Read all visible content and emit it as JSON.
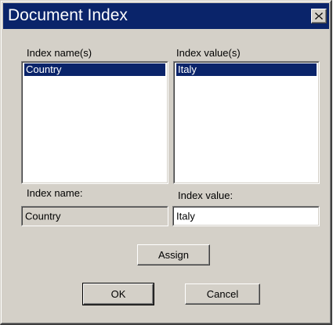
{
  "window": {
    "title": "Document Index"
  },
  "index_names": {
    "label": "Index name(s)",
    "items": [
      "Country"
    ],
    "selected_index": 0
  },
  "index_values": {
    "label": "Index value(s)",
    "items": [
      "Italy"
    ],
    "selected_index": 0
  },
  "index_name_field": {
    "label": "Index name:",
    "value": "Country"
  },
  "index_value_field": {
    "label": "Index value:",
    "value": "Italy"
  },
  "buttons": {
    "assign": "Assign",
    "ok": "OK",
    "cancel": "Cancel"
  },
  "colors": {
    "titlebar": "#0a246a",
    "selection": "#0a246a",
    "face": "#d4d0c8"
  }
}
